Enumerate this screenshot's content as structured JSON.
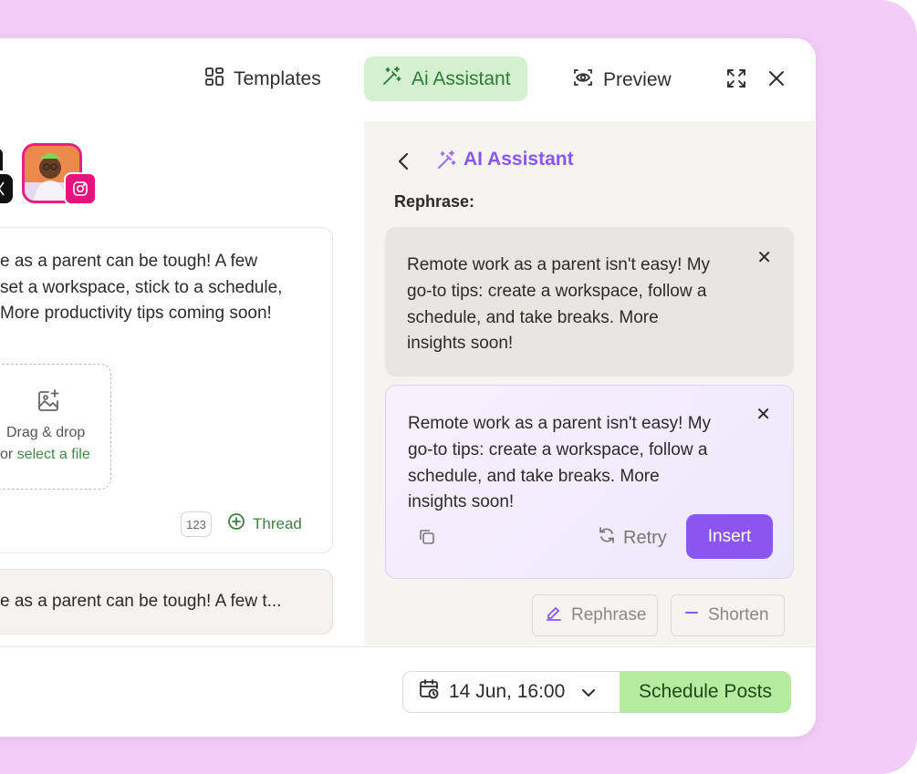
{
  "toolbar": {
    "templates_label": "Templates",
    "ai_assistant_label": "Ai Assistant",
    "preview_label": "Preview"
  },
  "editor": {
    "post_text": "e as a parent can be tough! A few\nset a workspace, stick to a schedule,\nMore productivity tips coming soon!",
    "drop_line1": "Drag & drop",
    "drop_or": "or ",
    "drop_link": "select a file",
    "char_count": "123",
    "thread_label": "Thread",
    "preview_snippet": "e as a parent can be tough! A few t..."
  },
  "assistant": {
    "title": "AI Assistant",
    "section_label": "Rephrase:",
    "suggestions": [
      {
        "text": "Remote work as a parent isn't easy! My\ngo-to tips: create a workspace, follow a\nschedule, and take breaks. More\ninsights soon!"
      },
      {
        "text": "Remote work as a parent isn't easy! My\ngo-to tips: create a workspace, follow a\nschedule, and take breaks. More\ninsights soon!"
      }
    ],
    "retry_label": "Retry",
    "insert_label": "Insert",
    "rephrase_label": "Rephrase",
    "shorten_label": "Shorten"
  },
  "footer": {
    "date_value": "14 Jun, 16:00",
    "schedule_label": "Schedule Posts"
  },
  "colors": {
    "background": "#f3ccf7",
    "accent_purple": "#8a55f0",
    "accent_green": "#b6ec9f",
    "ai_tab_bg": "#d4f1cf",
    "instagram_pink": "#e5137b"
  }
}
